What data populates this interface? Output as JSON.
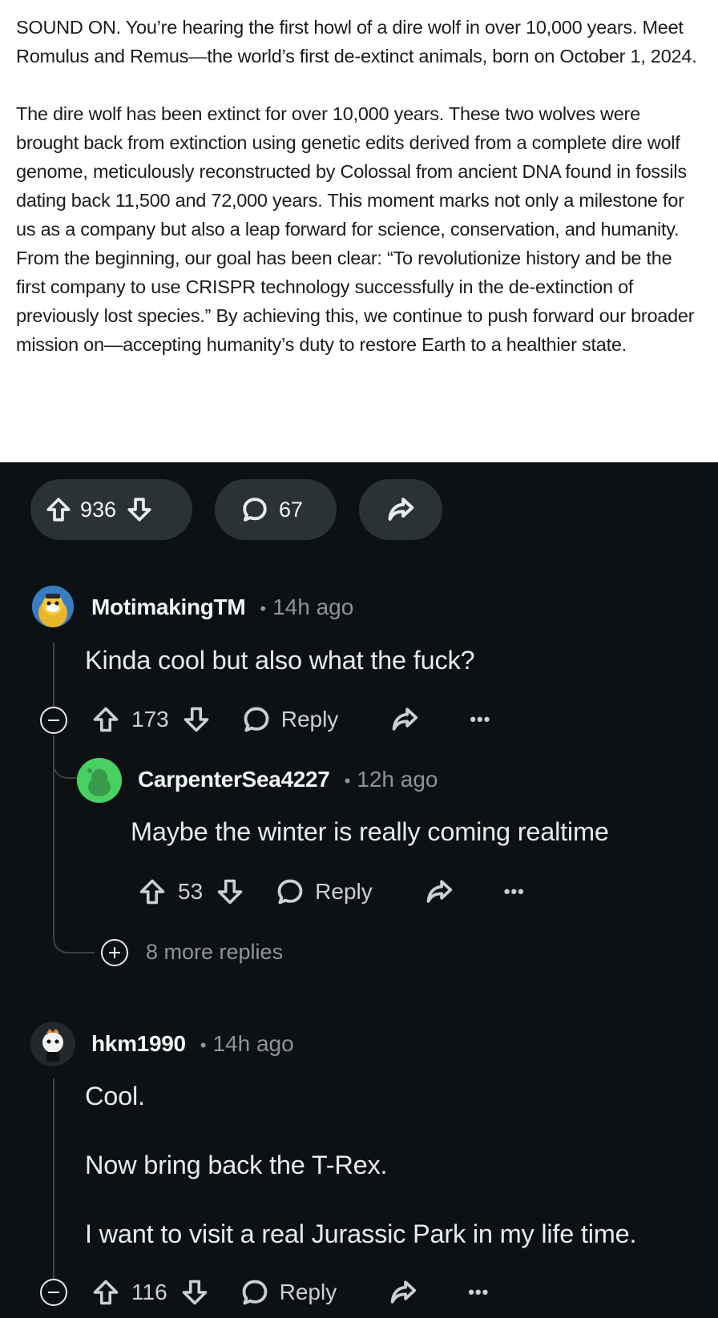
{
  "post": {
    "paragraphs": [
      "SOUND ON. You’re hearing the first howl of a dire wolf in over 10,000 years. Meet Romulus and Remus—the world’s first de-extinct animals, born on October 1, 2024.",
      "The dire wolf has been extinct for over 10,000 years. These two wolves were brought back from extinction using genetic edits derived from a complete dire wolf genome, meticulously reconstructed by Colossal from ancient DNA found in fossils dating back 11,500 and 72,000 years. This moment marks not only a milestone for us as a company but also a leap forward for science, conservation, and humanity. From the beginning, our goal has been clear: “To revolutionize history and be the first company to use CRISPR technology successfully in the de-extinction of previously lost species.” By achieving this, we continue to push forward our broader mission on—accepting humanity’s duty to restore Earth to a healthier state."
    ]
  },
  "post_actions": {
    "votes": "936",
    "comments": "67"
  },
  "comments": [
    {
      "username": "MotimakingTM",
      "dot": "•",
      "time": "14h ago",
      "text": [
        "Kinda cool but also what the fuck?"
      ],
      "votes": "173",
      "reply_label": "Reply",
      "more": "•••"
    },
    {
      "username": "CarpenterSea4227",
      "dot": "•",
      "time": "12h ago",
      "text": [
        "Maybe the winter is really coming realtime"
      ],
      "votes": "53",
      "reply_label": "Reply",
      "more": "•••"
    },
    {
      "username": "hkm1990",
      "dot": "•",
      "time": "14h ago",
      "text": [
        "Cool.",
        "Now bring back the T-Rex.",
        "I want to visit a real Jurassic Park in my life time."
      ],
      "votes": "116",
      "reply_label": "Reply",
      "more": "•••"
    }
  ],
  "more_replies": "8 more replies",
  "icons": [
    "upvote-icon",
    "downvote-icon",
    "comment-icon",
    "share-icon",
    "collapse-icon",
    "expand-icon",
    "overflow-icon"
  ]
}
